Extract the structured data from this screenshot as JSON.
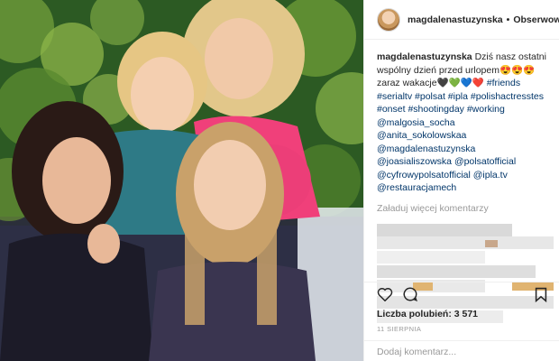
{
  "post": {
    "username": "magdalenastuzynska",
    "separator": "•",
    "follow_label": "Obserwowanie",
    "caption": {
      "user": "magdalenastuzynska",
      "text": "Dziś nasz ostatni wspólny dzień przed urlopem😍😍😍zaraz wakacje🖤💚💙❤️",
      "tags_line1": "#friends #serialtv #polsat #ipla #polishactresstes #onset #shootingday #working",
      "mentions": "@malgosia_socha @anita_sokolowskaa @magdalenastuzynska @joasialiszowska @polsatofficial @cyfrowypolsatofficial @ipla.tv @restauracjamech"
    },
    "load_more_label": "Załaduj więcej komentarzy",
    "likes_label": "Liczba polubień: 3 571",
    "date_label": "11 SIERPNIA",
    "add_comment_placeholder": "Dodaj komentarz...",
    "icons": {
      "like": "heart-icon",
      "comment": "comment-icon",
      "save": "bookmark-icon",
      "more": "ellipsis-icon"
    }
  },
  "colors": {
    "link": "#003569",
    "muted": "#999999",
    "border": "#efefef"
  }
}
